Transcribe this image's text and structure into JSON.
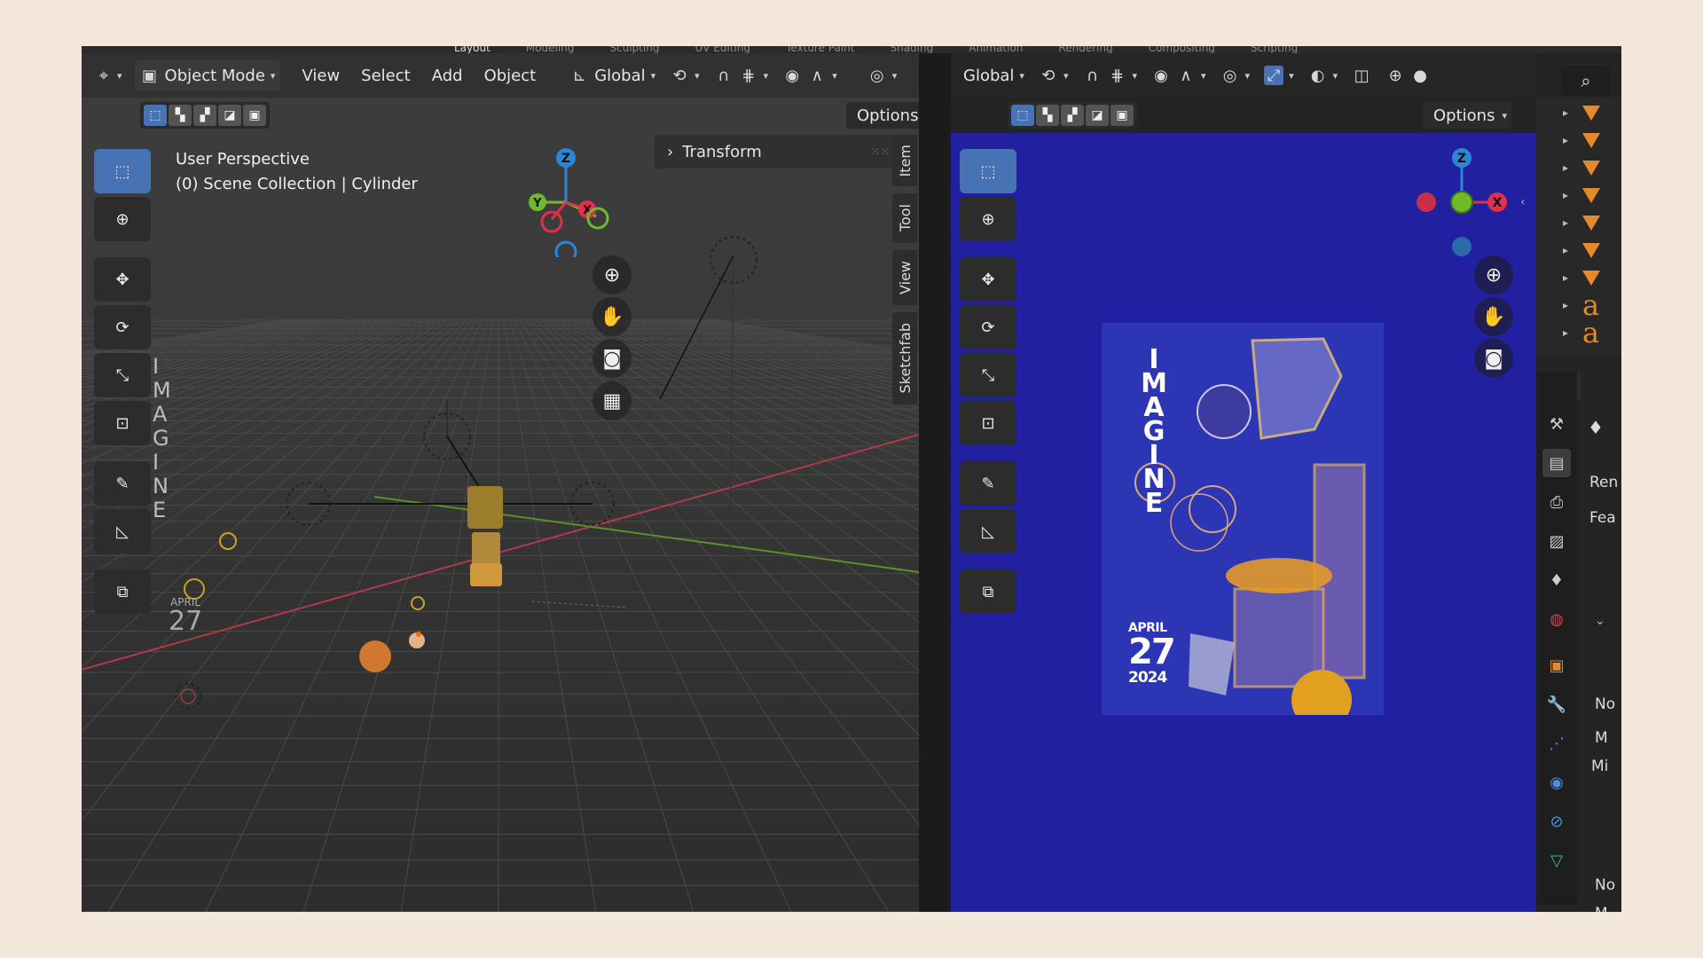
{
  "workspace_tabs": [
    "Layout",
    "Modeling",
    "Sculpting",
    "UV Editing",
    "Texture Paint",
    "Shading",
    "Animation",
    "Rendering",
    "Compositing",
    "Scripting"
  ],
  "left_viewport": {
    "header": {
      "mode_label": "Object Mode",
      "menu_view": "View",
      "menu_select": "Select",
      "menu_add": "Add",
      "menu_object": "Object",
      "orientation_label": "Global"
    },
    "options_label": "Options",
    "info_line1": "User Perspective",
    "info_line2": "(0) Scene Collection | Cylinder",
    "transform_panel_label": "Transform",
    "sidebar_tabs": [
      "Item",
      "Tool",
      "View",
      "Sketchfab"
    ],
    "scene_text_imagine": [
      "I",
      "M",
      "A",
      "G",
      "I",
      "N",
      "E"
    ],
    "scene_text_month": "APRIL",
    "scene_text_day": "27"
  },
  "right_viewport": {
    "orientation_label": "Global",
    "options_label": "Options",
    "poster": {
      "imagine_letters": [
        "I",
        "M",
        "A",
        "G",
        "I",
        "N",
        "E"
      ],
      "month": "APRIL",
      "day": "27",
      "year": "2024"
    }
  },
  "properties": {
    "text_render": "Ren",
    "text_features": "Fea",
    "text_n1": "No",
    "text_m": "M",
    "text_mi": "Mi",
    "text_n2": "No",
    "text_m2": "M"
  },
  "colors": {
    "background": "#f3e7dc",
    "accent_blue": "#4772b3",
    "viewport_blue": "#2020a0",
    "axis_x": "#e0304e",
    "axis_y": "#6fba2c",
    "axis_z": "#2a86d6",
    "outliner_orange": "#e58a2b"
  }
}
